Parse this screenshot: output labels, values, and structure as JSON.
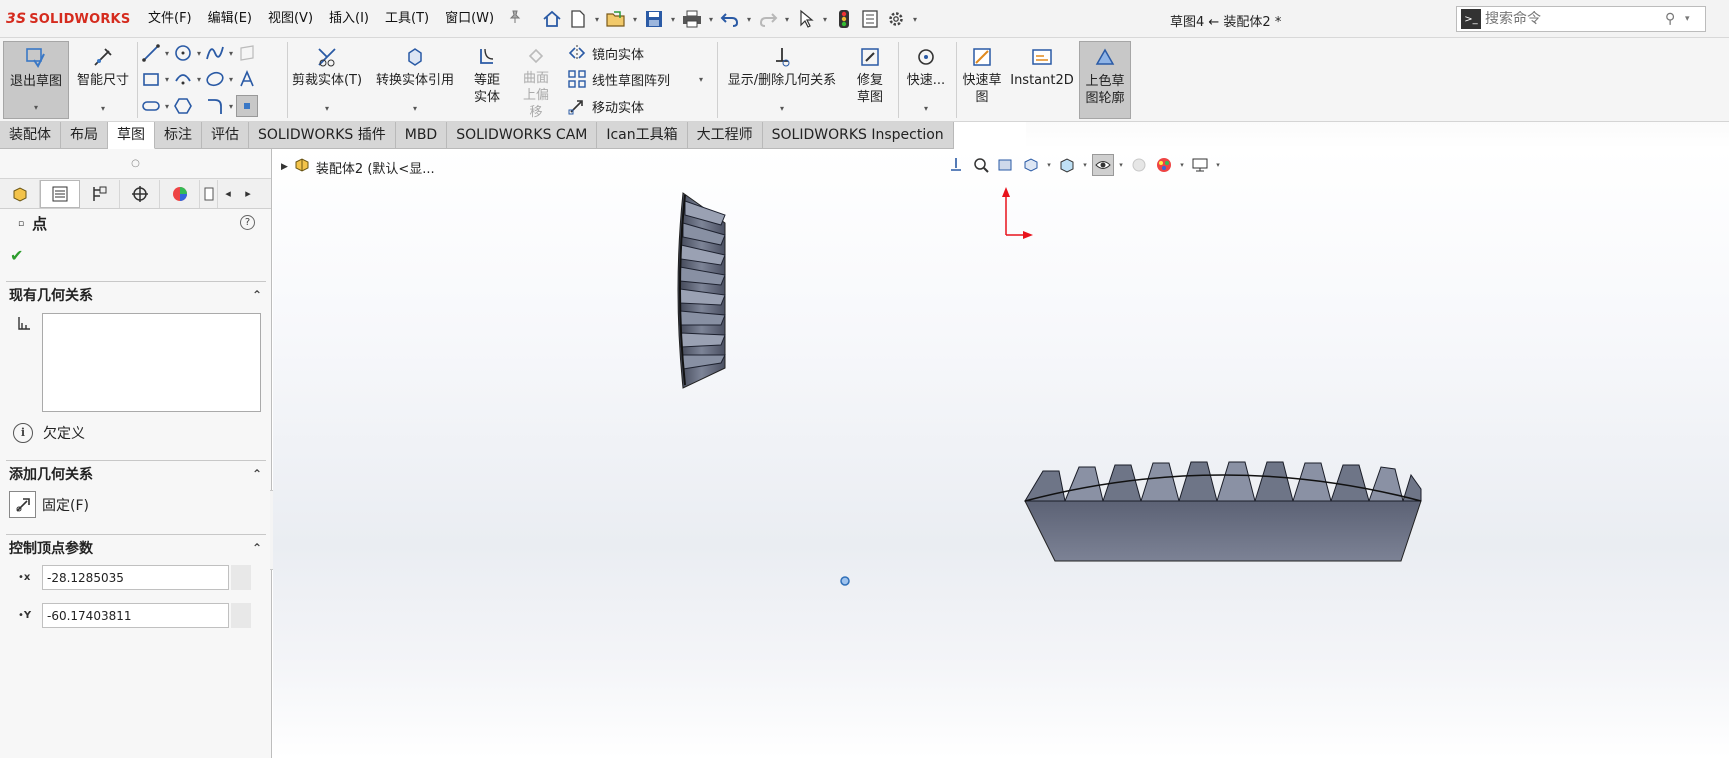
{
  "app": {
    "logo_prefix": "3S",
    "logo_text": "SOLIDWORKS",
    "document_title": "草图4 ← 装配体2 *",
    "search_placeholder": "搜索命令"
  },
  "menus": [
    "文件(F)",
    "编辑(E)",
    "视图(V)",
    "插入(I)",
    "工具(T)",
    "窗口(W)"
  ],
  "ribbon": {
    "exit_sketch": "退出草图",
    "smart_dimension": "智能尺寸",
    "trim_entities": "剪裁实体(T)",
    "convert_entities": "转换实体引用",
    "offset_entities": "等距实体",
    "offset_surface": "曲面上偏移",
    "mirror_entities": "镜向实体",
    "linear_pattern": "线性草图阵列",
    "move_entities": "移动实体",
    "display_relations": "显示/删除几何关系",
    "repair_sketch": "修复草图",
    "quick_snaps": "快速...",
    "rapid_sketch": "快速草图",
    "instant2d": "Instant2D",
    "shaded_contours": "上色草图轮廓"
  },
  "tabs": [
    {
      "label": "装配体",
      "active": false
    },
    {
      "label": "布局",
      "active": false
    },
    {
      "label": "草图",
      "active": true
    },
    {
      "label": "标注",
      "active": false
    },
    {
      "label": "评估",
      "active": false
    },
    {
      "label": "SOLIDWORKS 插件",
      "active": false
    },
    {
      "label": "MBD",
      "active": false
    },
    {
      "label": "SOLIDWORKS CAM",
      "active": false
    },
    {
      "label": "Ican工具箱",
      "active": false
    },
    {
      "label": "大工程师",
      "active": false
    },
    {
      "label": "SOLIDWORKS Inspection",
      "active": false
    }
  ],
  "property_manager": {
    "title": "点",
    "existing_relations": {
      "header": "现有几何关系"
    },
    "status": "欠定义",
    "add_relations": {
      "header": "添加几何关系",
      "fix_label": "固定(F)"
    },
    "vertex_params": {
      "header": "控制顶点参数",
      "x_label": "x",
      "y_label": "Y",
      "x_value": "-28.1285035",
      "y_value": "-60.17403811"
    }
  },
  "graphics": {
    "tree_root": "装配体2 (默认<显...",
    "triad_colors": {
      "x": "#e8131c",
      "y": "#e8131c"
    },
    "part_color": "#6e7587",
    "point_color": "#2f6fb8"
  }
}
